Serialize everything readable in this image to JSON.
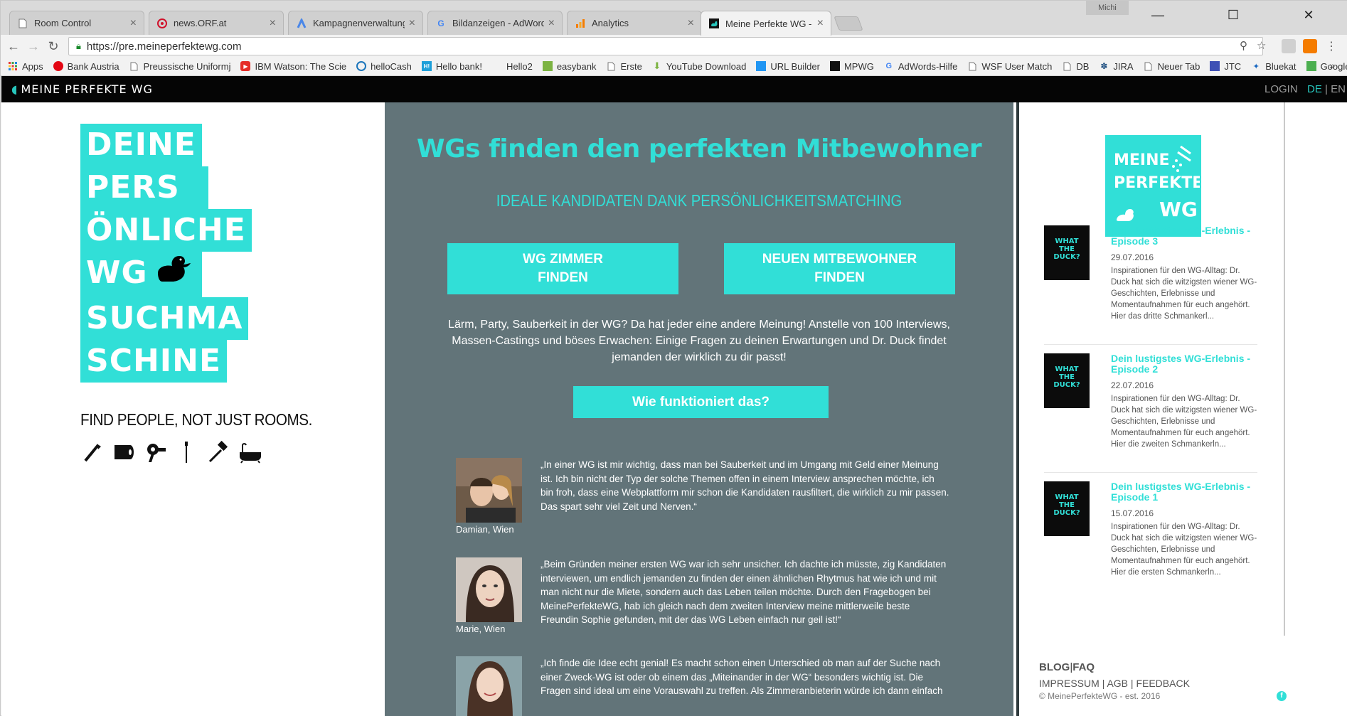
{
  "browser": {
    "tabs": [
      {
        "title": "Room Control",
        "icon": "page-icon"
      },
      {
        "title": "news.ORF.at",
        "icon": "orf-icon"
      },
      {
        "title": "Kampagnenverwaltung -",
        "icon": "adwords-icon"
      },
      {
        "title": "Bildanzeigen - AdWords",
        "icon": "google-icon"
      },
      {
        "title": "Analytics",
        "icon": "analytics-icon"
      },
      {
        "title": "Meine Perfekte WG - WG",
        "icon": "duck-icon"
      }
    ],
    "profile": "Michi",
    "url": "https://pre.meineperfektewg.com",
    "bookmarks": [
      {
        "label": "Apps",
        "icon": "apps-grid-icon"
      },
      {
        "label": "Bank Austria",
        "icon": "bank-icon"
      },
      {
        "label": "Preussische Uniformj",
        "icon": "page-icon"
      },
      {
        "label": "IBM Watson: The Scie",
        "icon": "youtube-icon"
      },
      {
        "label": "helloCash",
        "icon": "hellocash-icon"
      },
      {
        "label": "Hello bank!",
        "icon": "hello-icon"
      },
      {
        "label": "Hello2",
        "icon": "blank-icon"
      },
      {
        "label": "easybank",
        "icon": "easybank-icon"
      },
      {
        "label": "Erste",
        "icon": "page-icon"
      },
      {
        "label": "YouTube Download",
        "icon": "download-icon"
      },
      {
        "label": "URL Builder",
        "icon": "url-icon"
      },
      {
        "label": "MPWG",
        "icon": "duck-icon"
      },
      {
        "label": "AdWords-Hilfe",
        "icon": "google-icon"
      },
      {
        "label": "WSF User Match",
        "icon": "page-icon"
      },
      {
        "label": "DB",
        "icon": "page-icon"
      },
      {
        "label": "JIRA",
        "icon": "jira-icon"
      },
      {
        "label": "Neuer Tab",
        "icon": "page-icon"
      },
      {
        "label": "JTC",
        "icon": "jtc-icon"
      },
      {
        "label": "Bluekat",
        "icon": "bluekat-icon"
      },
      {
        "label": "Google Maps",
        "icon": "maps-icon"
      }
    ],
    "more": "»"
  },
  "site": {
    "nav": {
      "logo": "MEINE PERFEKTE WG",
      "login": "LOGIN",
      "lang_de": "DE",
      "lang_sep": " | ",
      "lang_en": "EN"
    },
    "hero": {
      "lines": [
        "DEINE",
        "PERS",
        "ÖNLICHE",
        "WG",
        "SUCHMA",
        "SCHINE"
      ],
      "tagline": "FIND PEOPLE, NOT JUST ROOMS.",
      "icons": [
        "razor-icon",
        "toilet-paper-icon",
        "hairdryer-icon",
        "toothbrush-icon",
        "shaver-icon",
        "bathtub-icon"
      ]
    },
    "main": {
      "title": "WGs finden den perfekten Mitbewohner",
      "subtitle": "IDEALE KANDIDATEN DANK PERSÖNLICHKEITSMATCHING",
      "cta_left_1": "WG ZIMMER",
      "cta_left_2": "FINDEN",
      "cta_right_1": "NEUEN MITBEWOHNER",
      "cta_right_2": "FINDEN",
      "intro": "Lärm, Party, Sauberkeit in der WG? Da hat jeder eine andere Meinung! Anstelle von 100 Interviews, Massen-Castings und böses Erwachen: Einige Fragen zu deinen Erwartungen und Dr. Duck findet jemanden der wirklich zu dir passt!",
      "how_button": "Wie funktioniert das?",
      "testimonials": [
        {
          "name": "Damian, Wien",
          "quote": "„In einer WG ist mir wichtig, dass man bei Sauberkeit und im Umgang mit Geld einer Meinung ist. Ich bin nicht der Typ der solche Themen offen in einem Interview ansprechen möchte, ich bin froh, dass eine Webplattform mir schon die Kandidaten rausfiltert, die wirklich zu mir passen. Das spart sehr viel Zeit und Nerven.“"
        },
        {
          "name": "Marie, Wien",
          "quote": "„Beim Gründen meiner ersten WG war ich sehr unsicher. Ich dachte ich müsste, zig Kandidaten interviewen, um endlich jemanden zu finden der einen ähnlichen Rhytmus hat wie ich und mit man nicht nur die Miete, sondern auch das Leben teilen möchte. Durch den Fragebogen bei MeinePerfekteWG, hab ich gleich nach dem zweiten Interview meine mittlerweile beste Freundin Sophie gefunden, mit der das WG Leben einfach nur geil ist!“"
        },
        {
          "name": "",
          "quote": "„Ich finde die Idee echt genial! Es macht schon einen Unterschied ob man auf der Suche nach einer Zweck-WG ist oder ob einem das „Miteinander in der WG“ besonders wichtig ist. Die Fragen sind ideal um eine Vorauswahl zu treffen. Als Zimmeranbieterin würde ich dann einfach"
        }
      ]
    },
    "sidebar": {
      "logo_line1": "MEINE",
      "logo_line2": "PERFEKTE",
      "logo_line3": "WG",
      "thumb_text_1": "WHAT",
      "thumb_text_2": "THE",
      "thumb_text_3": "DUCK?",
      "posts": [
        {
          "title": "Dein lustigstes WG-Erlebnis - Episode 3",
          "date": "29.07.2016",
          "desc": "Inspirationen für den WG-Alltag: Dr. Duck hat sich die witzigsten wiener WG-Geschichten, Erlebnisse und Momentaufnahmen für euch angehört. Hier das dritte Schmankerl..."
        },
        {
          "title": "Dein lustigstes WG-Erlebnis - Episode 2",
          "date": "22.07.2016",
          "desc": "Inspirationen für den WG-Alltag: Dr. Duck hat sich die witzigsten wiener WG-Geschichten, Erlebnisse und Momentaufnahmen für euch angehört. Hier die zweiten Schmankerln..."
        },
        {
          "title": "Dein lustigstes WG-Erlebnis - Episode 1",
          "date": "15.07.2016",
          "desc": "Inspirationen für den WG-Alltag: Dr. Duck hat sich die witzigsten wiener WG-Geschichten, Erlebnisse und Momentaufnahmen für euch angehört. Hier die ersten Schmankerln..."
        }
      ],
      "footer": {
        "blog": "BLOG",
        "sep": "|",
        "faq": "FAQ",
        "impressum": "IMPRESSUM",
        "agb": "AGB",
        "feedback": "FEEDBACK",
        "copyright": "© MeinePerfekteWG - est. 2016",
        "fb": "f"
      }
    }
  }
}
